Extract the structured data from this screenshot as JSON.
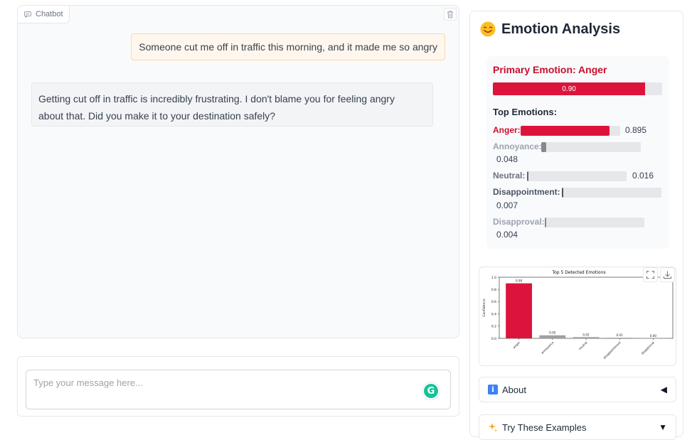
{
  "chatbot": {
    "label": "Chatbot",
    "messages": [
      {
        "role": "user",
        "text": "Someone cut me off in traffic this morning, and it made me so angry"
      },
      {
        "role": "bot",
        "line1": "Getting cut off in traffic is incredibly frustrating. I don't blame you for feeling angry",
        "line2": "about that. Did you make it to your destination safely?"
      }
    ]
  },
  "input": {
    "placeholder": "Type your message here...",
    "value": ""
  },
  "analysis": {
    "title": "Emotion Analysis",
    "primary_label": "Primary Emotion: Anger",
    "primary_value_text": "0.90",
    "primary_value": 0.9,
    "top_title": "Top Emotions:",
    "emotions": [
      {
        "label": "Anger:",
        "value": 0.895,
        "value_text": "0.895",
        "color": "#dc143c"
      },
      {
        "label": "Annoyance:",
        "value": 0.048,
        "value_text": "0.048",
        "color": "#888888"
      },
      {
        "label": "Neutral:",
        "value": 0.016,
        "value_text": "0.016",
        "color": "#666666"
      },
      {
        "label": "Disappointment:",
        "value": 0.007,
        "value_text": "0.007",
        "color": "#555555"
      },
      {
        "label": "Disapproval:",
        "value": 0.004,
        "value_text": "0.004",
        "color": "#888888"
      }
    ]
  },
  "chart_data": {
    "type": "bar",
    "title": "Top 5 Detected Emotions",
    "ylabel": "Confidence",
    "xlabel": "",
    "categories": [
      "anger",
      "annoyance",
      "neutral",
      "disappointment",
      "disapproval"
    ],
    "values": [
      0.9,
      0.05,
      0.02,
      0.01,
      0.0
    ],
    "value_labels": [
      "0.90",
      "0.05",
      "0.02",
      "0.01",
      "0.00"
    ],
    "colors": [
      "#dc143c",
      "#a0a0a0",
      "#a0a0a0",
      "#a0a0a0",
      "#a0a0a0"
    ],
    "ylim": [
      0,
      1.0
    ],
    "yticks": [
      "0.0",
      "0.2",
      "0.4",
      "0.6",
      "0.8",
      "1.0"
    ],
    "grid": false
  },
  "accordions": [
    {
      "label": "About",
      "arrow": "◀",
      "icon": "info-icon"
    },
    {
      "label": "Try These Examples",
      "arrow": "▼",
      "icon": "sparkles-icon"
    }
  ]
}
